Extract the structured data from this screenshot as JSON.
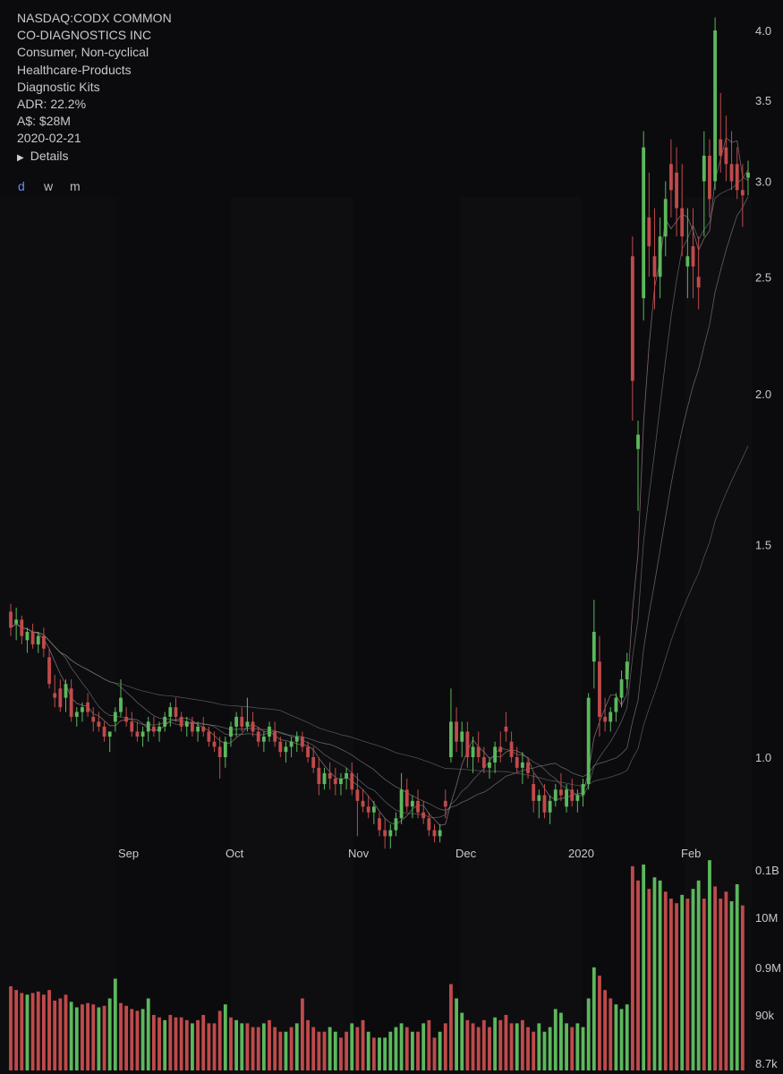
{
  "info": {
    "ticker": "NASDAQ:CODX COMMON",
    "name": "CO-DIAGNOSTICS INC",
    "sector": "Consumer, Non-cyclical",
    "industry": "Healthcare-Products",
    "subindustry": "Diagnostic Kits",
    "adr": "ADR: 22.2%",
    "mcap": "A$: $28M",
    "date": "2020-02-21",
    "details_label": "Details"
  },
  "timeframes": [
    "d",
    "w",
    "m"
  ],
  "active_timeframe": "d",
  "colors": {
    "background": "#0b0b0e",
    "up": "#5cb85c",
    "down": "#c04a4a",
    "text": "#c9c9c9",
    "accent": "#6b8df0"
  },
  "chart_data": {
    "type": "candlestick",
    "price_axis": {
      "scale": "log",
      "ticks": [
        "4.0",
        "3.5",
        "3.0",
        "2.5",
        "2.0",
        "1.5",
        "1.0"
      ]
    },
    "volume_axis": {
      "scale": "log",
      "ticks": [
        "0.1B",
        "10M",
        "0.9M",
        "90k",
        "8.7k"
      ]
    },
    "x_ticks": [
      "Sep",
      "Oct",
      "Nov",
      "Dec",
      "2020",
      "Feb"
    ],
    "candles": [
      [
        1.32,
        1.34,
        1.26,
        1.28
      ],
      [
        1.29,
        1.33,
        1.25,
        1.3
      ],
      [
        1.3,
        1.31,
        1.24,
        1.26
      ],
      [
        1.25,
        1.28,
        1.22,
        1.27
      ],
      [
        1.27,
        1.29,
        1.23,
        1.24
      ],
      [
        1.24,
        1.27,
        1.22,
        1.26
      ],
      [
        1.26,
        1.28,
        1.21,
        1.23
      ],
      [
        1.21,
        1.23,
        1.14,
        1.15
      ],
      [
        1.13,
        1.17,
        1.1,
        1.12
      ],
      [
        1.14,
        1.16,
        1.09,
        1.1
      ],
      [
        1.12,
        1.16,
        1.09,
        1.15
      ],
      [
        1.14,
        1.16,
        1.07,
        1.08
      ],
      [
        1.08,
        1.1,
        1.06,
        1.09
      ],
      [
        1.09,
        1.11,
        1.07,
        1.1
      ],
      [
        1.11,
        1.13,
        1.08,
        1.09
      ],
      [
        1.08,
        1.1,
        1.05,
        1.07
      ],
      [
        1.07,
        1.09,
        1.05,
        1.06
      ],
      [
        1.06,
        1.07,
        1.03,
        1.04
      ],
      [
        1.04,
        1.05,
        1.01,
        1.05
      ],
      [
        1.07,
        1.1,
        1.05,
        1.09
      ],
      [
        1.09,
        1.16,
        1.08,
        1.12
      ],
      [
        1.08,
        1.1,
        1.06,
        1.07
      ],
      [
        1.07,
        1.09,
        1.04,
        1.05
      ],
      [
        1.05,
        1.07,
        1.03,
        1.04
      ],
      [
        1.04,
        1.06,
        1.02,
        1.05
      ],
      [
        1.05,
        1.08,
        1.03,
        1.07
      ],
      [
        1.06,
        1.08,
        1.04,
        1.05
      ],
      [
        1.05,
        1.07,
        1.03,
        1.06
      ],
      [
        1.06,
        1.09,
        1.05,
        1.08
      ],
      [
        1.08,
        1.11,
        1.06,
        1.1
      ],
      [
        1.1,
        1.12,
        1.07,
        1.08
      ],
      [
        1.08,
        1.09,
        1.05,
        1.06
      ],
      [
        1.06,
        1.08,
        1.04,
        1.07
      ],
      [
        1.07,
        1.08,
        1.04,
        1.05
      ],
      [
        1.05,
        1.07,
        1.03,
        1.06
      ],
      [
        1.06,
        1.08,
        1.04,
        1.05
      ],
      [
        1.05,
        1.06,
        1.02,
        1.03
      ],
      [
        1.03,
        1.05,
        1.01,
        1.02
      ],
      [
        1.02,
        1.04,
        0.96,
        1.0
      ],
      [
        1.0,
        1.04,
        0.98,
        1.03
      ],
      [
        1.04,
        1.07,
        1.02,
        1.06
      ],
      [
        1.06,
        1.09,
        1.04,
        1.08
      ],
      [
        1.08,
        1.1,
        1.05,
        1.06
      ],
      [
        1.06,
        1.12,
        1.05,
        1.07
      ],
      [
        1.07,
        1.09,
        1.04,
        1.05
      ],
      [
        1.05,
        1.06,
        1.02,
        1.03
      ],
      [
        1.03,
        1.05,
        1.01,
        1.04
      ],
      [
        1.04,
        1.07,
        1.03,
        1.06
      ],
      [
        1.05,
        1.07,
        1.02,
        1.03
      ],
      [
        1.03,
        1.04,
        1.0,
        1.01
      ],
      [
        1.01,
        1.03,
        0.99,
        1.02
      ],
      [
        1.02,
        1.04,
        1.0,
        1.03
      ],
      [
        1.03,
        1.05,
        1.01,
        1.04
      ],
      [
        1.04,
        1.05,
        1.01,
        1.02
      ],
      [
        1.02,
        1.03,
        0.99,
        1.0
      ],
      [
        1.0,
        1.02,
        0.97,
        0.98
      ],
      [
        0.98,
        1.0,
        0.93,
        0.95
      ],
      [
        0.95,
        0.98,
        0.94,
        0.97
      ],
      [
        0.97,
        0.99,
        0.94,
        0.96
      ],
      [
        0.96,
        0.98,
        0.93,
        0.95
      ],
      [
        0.95,
        0.97,
        0.93,
        0.96
      ],
      [
        0.96,
        0.98,
        0.94,
        0.97
      ],
      [
        0.97,
        0.99,
        0.93,
        0.94
      ],
      [
        0.94,
        0.97,
        0.86,
        0.92
      ],
      [
        0.92,
        0.94,
        0.9,
        0.91
      ],
      [
        0.91,
        0.93,
        0.89,
        0.9
      ],
      [
        0.9,
        0.92,
        0.88,
        0.91
      ],
      [
        0.89,
        0.9,
        0.86,
        0.87
      ],
      [
        0.87,
        0.89,
        0.84,
        0.86
      ],
      [
        0.86,
        0.88,
        0.84,
        0.87
      ],
      [
        0.87,
        0.9,
        0.86,
        0.89
      ],
      [
        0.89,
        0.97,
        0.88,
        0.94
      ],
      [
        0.94,
        0.96,
        0.9,
        0.91
      ],
      [
        0.91,
        0.93,
        0.89,
        0.92
      ],
      [
        0.92,
        0.94,
        0.89,
        0.9
      ],
      [
        0.9,
        0.92,
        0.88,
        0.89
      ],
      [
        0.89,
        0.9,
        0.86,
        0.87
      ],
      [
        0.87,
        0.88,
        0.85,
        0.86
      ],
      [
        0.86,
        0.88,
        0.85,
        0.87
      ],
      [
        0.92,
        0.94,
        0.89,
        0.91
      ],
      [
        1.0,
        1.14,
        0.99,
        1.07
      ],
      [
        1.07,
        1.1,
        1.01,
        1.03
      ],
      [
        1.03,
        1.07,
        1.0,
        1.05
      ],
      [
        1.05,
        1.07,
        0.98,
        1.0
      ],
      [
        1.0,
        1.04,
        0.97,
        1.02
      ],
      [
        1.02,
        1.05,
        0.99,
        1.0
      ],
      [
        1.0,
        1.02,
        0.97,
        0.98
      ],
      [
        0.98,
        1.0,
        0.96,
        0.99
      ],
      [
        0.99,
        1.03,
        0.97,
        1.02
      ],
      [
        1.02,
        1.05,
        0.99,
        1.01
      ],
      [
        1.06,
        1.09,
        1.03,
        1.05
      ],
      [
        1.03,
        1.05,
        0.99,
        1.0
      ],
      [
        1.0,
        1.02,
        0.97,
        0.98
      ],
      [
        0.98,
        1.01,
        0.95,
        0.99
      ],
      [
        0.99,
        1.0,
        0.96,
        0.97
      ],
      [
        0.95,
        0.97,
        0.9,
        0.92
      ],
      [
        0.92,
        0.94,
        0.89,
        0.93
      ],
      [
        0.93,
        0.95,
        0.89,
        0.9
      ],
      [
        0.9,
        0.93,
        0.88,
        0.92
      ],
      [
        0.92,
        0.95,
        0.91,
        0.94
      ],
      [
        0.94,
        0.97,
        0.92,
        0.93
      ],
      [
        0.91,
        0.95,
        0.9,
        0.94
      ],
      [
        0.94,
        0.96,
        0.91,
        0.92
      ],
      [
        0.92,
        0.94,
        0.9,
        0.93
      ],
      [
        0.93,
        0.96,
        0.91,
        0.95
      ],
      [
        0.95,
        1.13,
        0.94,
        1.12
      ],
      [
        1.2,
        1.35,
        1.14,
        1.27
      ],
      [
        1.2,
        1.26,
        1.04,
        1.08
      ],
      [
        1.08,
        1.12,
        1.05,
        1.07
      ],
      [
        1.07,
        1.1,
        1.05,
        1.09
      ],
      [
        1.09,
        1.13,
        1.07,
        1.12
      ],
      [
        1.12,
        1.18,
        1.1,
        1.16
      ],
      [
        1.16,
        1.22,
        1.14,
        1.2
      ],
      [
        2.6,
        2.7,
        1.9,
        2.05
      ],
      [
        1.8,
        1.9,
        1.6,
        1.85
      ],
      [
        2.4,
        3.3,
        2.3,
        3.2
      ],
      [
        2.8,
        3.05,
        2.5,
        2.65
      ],
      [
        2.6,
        2.85,
        2.35,
        2.5
      ],
      [
        2.5,
        2.8,
        2.4,
        2.7
      ],
      [
        2.7,
        3.0,
        2.6,
        2.9
      ],
      [
        3.1,
        3.25,
        2.8,
        2.95
      ],
      [
        3.05,
        3.2,
        2.7,
        2.85
      ],
      [
        2.85,
        3.1,
        2.6,
        2.7
      ],
      [
        2.55,
        2.85,
        2.4,
        2.6
      ],
      [
        2.65,
        2.85,
        2.4,
        2.55
      ],
      [
        2.5,
        2.7,
        2.35,
        2.45
      ],
      [
        3.0,
        3.3,
        2.7,
        3.15
      ],
      [
        3.15,
        3.25,
        2.8,
        2.9
      ],
      [
        3.0,
        4.1,
        2.95,
        4.0
      ],
      [
        3.25,
        3.55,
        3.05,
        3.15
      ],
      [
        3.2,
        3.4,
        3.0,
        3.1
      ],
      [
        3.1,
        3.3,
        2.95,
        3.0
      ],
      [
        3.1,
        3.2,
        2.9,
        2.95
      ],
      [
        2.95,
        3.1,
        2.75,
        2.92
      ],
      [
        3.02,
        3.12,
        2.92,
        3.05
      ]
    ],
    "volume": [
      [
        360000,
        "down"
      ],
      [
        300000,
        "down"
      ],
      [
        260000,
        "down"
      ],
      [
        240000,
        "up"
      ],
      [
        260000,
        "down"
      ],
      [
        280000,
        "down"
      ],
      [
        240000,
        "down"
      ],
      [
        300000,
        "down"
      ],
      [
        180000,
        "down"
      ],
      [
        200000,
        "down"
      ],
      [
        240000,
        "down"
      ],
      [
        170000,
        "up"
      ],
      [
        130000,
        "up"
      ],
      [
        150000,
        "down"
      ],
      [
        160000,
        "down"
      ],
      [
        150000,
        "down"
      ],
      [
        130000,
        "up"
      ],
      [
        140000,
        "down"
      ],
      [
        200000,
        "up"
      ],
      [
        520000,
        "up"
      ],
      [
        160000,
        "down"
      ],
      [
        140000,
        "down"
      ],
      [
        120000,
        "down"
      ],
      [
        110000,
        "down"
      ],
      [
        120000,
        "up"
      ],
      [
        200000,
        "up"
      ],
      [
        90000,
        "down"
      ],
      [
        80000,
        "down"
      ],
      [
        70000,
        "up"
      ],
      [
        90000,
        "down"
      ],
      [
        80000,
        "down"
      ],
      [
        80000,
        "down"
      ],
      [
        70000,
        "down"
      ],
      [
        60000,
        "up"
      ],
      [
        70000,
        "down"
      ],
      [
        90000,
        "down"
      ],
      [
        60000,
        "down"
      ],
      [
        60000,
        "down"
      ],
      [
        110000,
        "down"
      ],
      [
        150000,
        "up"
      ],
      [
        80000,
        "down"
      ],
      [
        70000,
        "up"
      ],
      [
        60000,
        "up"
      ],
      [
        60000,
        "down"
      ],
      [
        50000,
        "down"
      ],
      [
        50000,
        "down"
      ],
      [
        60000,
        "up"
      ],
      [
        70000,
        "down"
      ],
      [
        50000,
        "down"
      ],
      [
        40000,
        "down"
      ],
      [
        40000,
        "up"
      ],
      [
        50000,
        "down"
      ],
      [
        60000,
        "up"
      ],
      [
        200000,
        "down"
      ],
      [
        70000,
        "down"
      ],
      [
        50000,
        "down"
      ],
      [
        40000,
        "down"
      ],
      [
        40000,
        "down"
      ],
      [
        50000,
        "up"
      ],
      [
        40000,
        "up"
      ],
      [
        30000,
        "down"
      ],
      [
        40000,
        "down"
      ],
      [
        60000,
        "up"
      ],
      [
        50000,
        "down"
      ],
      [
        70000,
        "down"
      ],
      [
        40000,
        "up"
      ],
      [
        30000,
        "down"
      ],
      [
        30000,
        "up"
      ],
      [
        30000,
        "up"
      ],
      [
        40000,
        "up"
      ],
      [
        50000,
        "up"
      ],
      [
        60000,
        "up"
      ],
      [
        50000,
        "down"
      ],
      [
        40000,
        "up"
      ],
      [
        40000,
        "down"
      ],
      [
        60000,
        "up"
      ],
      [
        70000,
        "down"
      ],
      [
        30000,
        "down"
      ],
      [
        40000,
        "up"
      ],
      [
        60000,
        "down"
      ],
      [
        400000,
        "down"
      ],
      [
        200000,
        "up"
      ],
      [
        100000,
        "up"
      ],
      [
        70000,
        "down"
      ],
      [
        60000,
        "down"
      ],
      [
        50000,
        "down"
      ],
      [
        70000,
        "down"
      ],
      [
        50000,
        "down"
      ],
      [
        80000,
        "up"
      ],
      [
        70000,
        "down"
      ],
      [
        90000,
        "down"
      ],
      [
        60000,
        "down"
      ],
      [
        60000,
        "up"
      ],
      [
        70000,
        "down"
      ],
      [
        50000,
        "down"
      ],
      [
        40000,
        "down"
      ],
      [
        60000,
        "up"
      ],
      [
        40000,
        "up"
      ],
      [
        50000,
        "up"
      ],
      [
        120000,
        "up"
      ],
      [
        100000,
        "up"
      ],
      [
        60000,
        "up"
      ],
      [
        50000,
        "down"
      ],
      [
        60000,
        "up"
      ],
      [
        50000,
        "up"
      ],
      [
        200000,
        "up"
      ],
      [
        900000,
        "up"
      ],
      [
        600000,
        "down"
      ],
      [
        300000,
        "down"
      ],
      [
        200000,
        "down"
      ],
      [
        150000,
        "up"
      ],
      [
        120000,
        "up"
      ],
      [
        150000,
        "up"
      ],
      [
        120000000,
        "down"
      ],
      [
        60000000,
        "down"
      ],
      [
        130000000,
        "up"
      ],
      [
        40000000,
        "down"
      ],
      [
        70000000,
        "up"
      ],
      [
        60000000,
        "up"
      ],
      [
        35000000,
        "down"
      ],
      [
        25000000,
        "down"
      ],
      [
        20000000,
        "down"
      ],
      [
        30000000,
        "up"
      ],
      [
        25000000,
        "down"
      ],
      [
        40000000,
        "up"
      ],
      [
        60000000,
        "up"
      ],
      [
        25000000,
        "down"
      ],
      [
        160000000,
        "up"
      ],
      [
        45000000,
        "down"
      ],
      [
        25000000,
        "down"
      ],
      [
        35000000,
        "down"
      ],
      [
        22000000,
        "up"
      ],
      [
        50000000,
        "up"
      ],
      [
        18000000,
        "down"
      ]
    ]
  }
}
